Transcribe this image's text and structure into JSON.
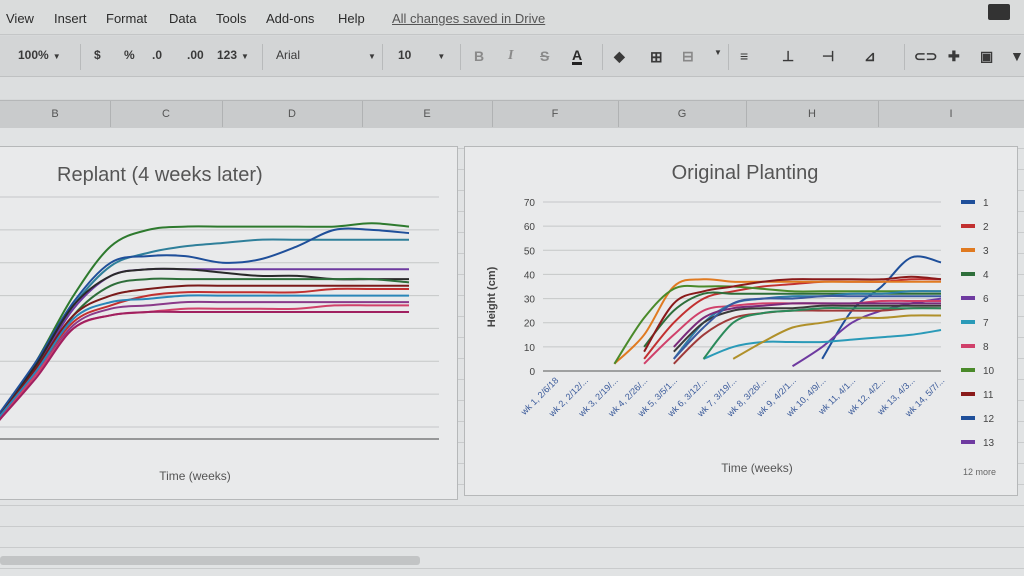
{
  "menu": [
    "View",
    "Insert",
    "Format",
    "Data",
    "Tools",
    "Add-ons",
    "Help"
  ],
  "save_status": "All changes saved in Drive",
  "toolbar": {
    "zoom": "100%",
    "currency": "$",
    "percent": "%",
    "decrease_decimal": ".0",
    "increase_decimal": ".00",
    "more_formats": "123",
    "font": "Arial",
    "font_size": "10",
    "bold": "B",
    "italic": "I",
    "strikethrough": "S",
    "text_color": "A"
  },
  "columns": [
    "B",
    "C",
    "D",
    "E",
    "F",
    "G",
    "H",
    "I"
  ],
  "chart_data": [
    {
      "type": "line",
      "title": "Replant (4 weeks later)",
      "xlabel": "Time (weeks)",
      "ylabel": "",
      "ylim": [
        0,
        70
      ],
      "x": [
        1,
        2,
        3,
        4,
        5,
        6,
        7,
        8,
        9,
        10,
        11,
        12
      ],
      "series": [
        {
          "color": "#2e7a2e",
          "values": [
            2,
            20,
            40,
            55,
            60,
            61,
            61,
            61,
            61,
            61,
            62,
            61
          ]
        },
        {
          "color": "#2f7f9a",
          "values": [
            3,
            19,
            37,
            49,
            53,
            55,
            56,
            57,
            57,
            57,
            57,
            57
          ]
        },
        {
          "color": "#1f4f9a",
          "values": [
            4,
            20,
            38,
            50,
            52,
            52,
            50,
            51,
            55,
            60,
            60,
            59
          ]
        },
        {
          "color": "#6e3aa0",
          "values": [
            2,
            18,
            36,
            46,
            48,
            48,
            48,
            48,
            48,
            48,
            48,
            48
          ]
        },
        {
          "color": "#2a2a2a",
          "values": [
            3,
            19,
            37,
            46,
            48,
            48,
            47,
            46,
            46,
            45,
            45,
            45
          ]
        },
        {
          "color": "#2e6e3a",
          "values": [
            2,
            17,
            34,
            43,
            45,
            45,
            45,
            45,
            45,
            45,
            45,
            44
          ]
        },
        {
          "color": "#7a1a1a",
          "values": [
            3,
            18,
            34,
            40,
            42,
            43,
            43,
            43,
            43,
            43,
            43,
            43
          ]
        },
        {
          "color": "#c23030",
          "values": [
            2,
            17,
            32,
            37,
            40,
            41,
            41,
            41,
            41,
            42,
            42,
            42
          ]
        },
        {
          "color": "#2a86b8",
          "values": [
            3,
            17,
            33,
            38,
            39,
            40,
            40,
            40,
            40,
            40,
            40,
            40
          ]
        },
        {
          "color": "#8a3a8a",
          "values": [
            2,
            16,
            31,
            36,
            37,
            38,
            38,
            38,
            38,
            38,
            38,
            38
          ]
        },
        {
          "color": "#d0406a",
          "values": [
            2,
            16,
            30,
            34,
            35,
            36,
            36,
            36,
            36,
            37,
            37,
            37
          ]
        },
        {
          "color": "#a02060",
          "values": [
            2,
            15,
            30,
            34,
            35,
            35,
            35,
            35,
            35,
            35,
            35,
            35
          ]
        }
      ]
    },
    {
      "type": "line",
      "title": "Original Planting",
      "xlabel": "Time (weeks)",
      "ylabel": "Height (cm)",
      "ylim": [
        0,
        70
      ],
      "yticks": [
        0,
        10,
        20,
        30,
        40,
        50,
        60,
        70
      ],
      "categories": [
        "wk 1, 2/6/18",
        "wk 2, 2/12/...",
        "wk 3, 2/19/...",
        "wk 4, 2/26/...",
        "wk 5, 3/5/1...",
        "wk 6, 3/12/...",
        "wk 7, 3/19/...",
        "wk 8, 3/26/...",
        "wk 9, 4/2/1...",
        "wk 10, 4/9/...",
        "wk 11, 4/1...",
        "wk 12, 4/2...",
        "wk 13, 4/3...",
        "wk 14, 5/7/..."
      ],
      "legend": {
        "position": "right",
        "entries": [
          {
            "name": "1",
            "color": "#1f4f9a"
          },
          {
            "name": "2",
            "color": "#c23030"
          },
          {
            "name": "3",
            "color": "#e07a20"
          },
          {
            "name": "4",
            "color": "#2e6e3a"
          },
          {
            "name": "6",
            "color": "#6e3aa0"
          },
          {
            "name": "7",
            "color": "#2a9ab8"
          },
          {
            "name": "8",
            "color": "#d0406a"
          },
          {
            "name": "10",
            "color": "#4a8a2a"
          },
          {
            "name": "11",
            "color": "#8a1a1a"
          },
          {
            "name": "12",
            "color": "#1f4f9a"
          },
          {
            "name": "13",
            "color": "#6e3aa0"
          }
        ],
        "more": "12 more"
      },
      "series": [
        {
          "color": "#1f4f9a",
          "values": [
            null,
            null,
            null,
            null,
            null,
            null,
            null,
            null,
            null,
            5,
            25,
            35,
            47,
            45
          ]
        },
        {
          "color": "#c23030",
          "values": [
            null,
            null,
            null,
            5,
            20,
            30,
            33,
            35,
            36,
            37,
            37,
            37,
            38,
            38
          ]
        },
        {
          "color": "#e07a20",
          "values": [
            null,
            null,
            3,
            15,
            35,
            38,
            37,
            37,
            37,
            37,
            37,
            37,
            37,
            37
          ]
        },
        {
          "color": "#2e6e3a",
          "values": [
            null,
            null,
            null,
            10,
            25,
            32,
            32,
            32,
            32,
            32,
            32,
            32,
            32,
            32
          ]
        },
        {
          "color": "#6e3aa0",
          "values": [
            null,
            null,
            null,
            null,
            null,
            null,
            null,
            null,
            2,
            10,
            20,
            25,
            28,
            30
          ]
        },
        {
          "color": "#2a9ab8",
          "values": [
            null,
            null,
            null,
            null,
            null,
            5,
            10,
            12,
            12,
            12,
            13,
            14,
            15,
            17
          ]
        },
        {
          "color": "#d0406a",
          "values": [
            null,
            null,
            null,
            3,
            15,
            25,
            27,
            28,
            28,
            28,
            28,
            29,
            29,
            29
          ]
        },
        {
          "color": "#4a8a2a",
          "values": [
            null,
            null,
            3,
            22,
            34,
            35,
            35,
            34,
            33,
            33,
            33,
            33,
            33,
            33
          ]
        },
        {
          "color": "#8a1a1a",
          "values": [
            null,
            null,
            null,
            8,
            28,
            33,
            35,
            37,
            38,
            38,
            38,
            38,
            39,
            38
          ]
        },
        {
          "color": "#2e7fa8",
          "values": [
            null,
            null,
            null,
            null,
            5,
            20,
            28,
            30,
            31,
            31,
            32,
            32,
            33,
            33
          ]
        },
        {
          "color": "#7a2a7a",
          "values": [
            null,
            null,
            null,
            null,
            10,
            22,
            26,
            27,
            28,
            28,
            28,
            28,
            28,
            28
          ]
        },
        {
          "color": "#3a3a3a",
          "values": [
            null,
            null,
            null,
            null,
            8,
            20,
            25,
            26,
            26,
            27,
            27,
            27,
            27,
            27
          ]
        },
        {
          "color": "#b0902a",
          "values": [
            null,
            null,
            null,
            null,
            null,
            null,
            5,
            12,
            18,
            20,
            22,
            22,
            23,
            23
          ]
        },
        {
          "color": "#3a5aa0",
          "values": [
            null,
            null,
            null,
            null,
            5,
            18,
            28,
            30,
            30,
            31,
            31,
            31,
            31,
            31
          ]
        },
        {
          "color": "#a03a3a",
          "values": [
            null,
            null,
            null,
            null,
            3,
            15,
            22,
            24,
            25,
            25,
            25,
            25,
            26,
            26
          ]
        },
        {
          "color": "#2a8a5a",
          "values": [
            null,
            null,
            null,
            null,
            null,
            5,
            20,
            24,
            25,
            26,
            26,
            26,
            26,
            26
          ]
        }
      ]
    }
  ]
}
